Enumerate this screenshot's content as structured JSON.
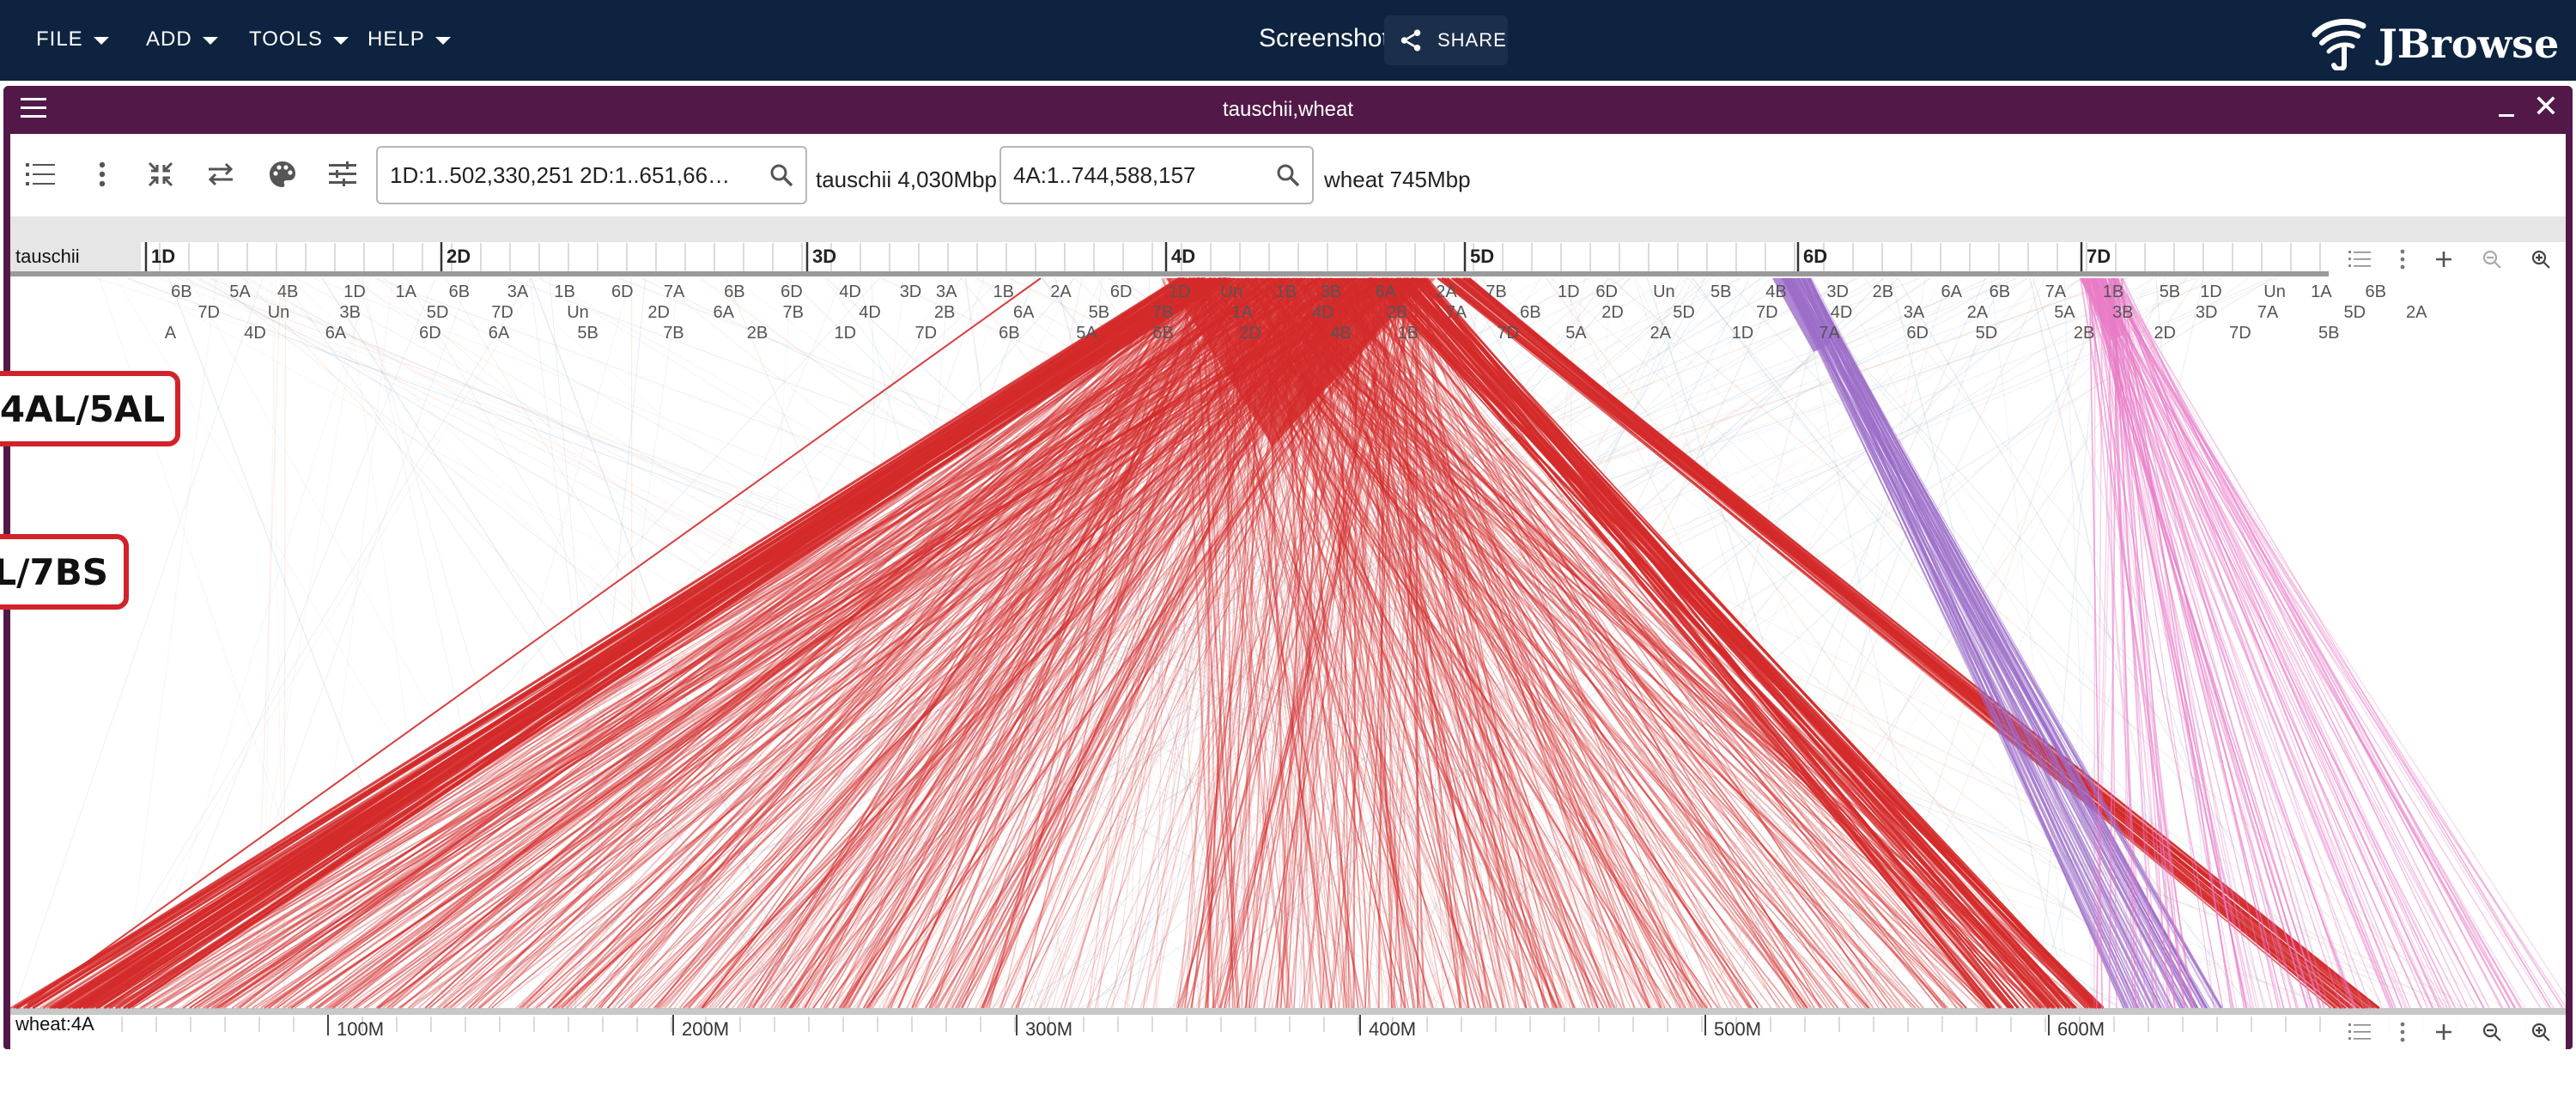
{
  "app": {
    "menus": [
      "FILE",
      "ADD",
      "TOOLS",
      "HELP"
    ],
    "title": "Screenshot",
    "share_label": "SHARE",
    "logo_text": "JBrowse",
    "header_color": "#0d233f"
  },
  "view": {
    "title": "tauschii,wheat",
    "header_color": "#521948",
    "location_1": "1D:1..502,330,251 2D:1..651,66…",
    "assembly_1_info": "tauschii 4,030Mbp",
    "location_2": "4A:1..744,588,157",
    "assembly_2_info": "wheat 745Mbp",
    "top_assembly_name": "tauschii",
    "bottom_assembly_name": "wheat:4A",
    "top_chromosomes": [
      "1D",
      "2D",
      "3D",
      "4D",
      "5D",
      "6D",
      "7D"
    ],
    "bottom_ticks": [
      "100M",
      "200M",
      "300M",
      "400M",
      "500M",
      "600M"
    ],
    "feature_label_rows": [
      [
        "6B",
        "5A",
        "4B",
        "1D",
        "1A",
        "6B",
        "3A",
        "1B",
        "6D",
        "7A",
        "6B",
        "6D",
        "4D",
        "3D",
        "3A",
        "1B",
        "2A",
        "6D",
        "1D",
        "Un",
        "1B",
        "3B",
        "6A",
        "2A",
        "7B",
        "1D",
        "6D",
        "Un",
        "5B",
        "4B",
        "3D",
        "2B",
        "6A",
        "6B",
        "7A",
        "1B",
        "5B",
        "1D",
        "Un",
        "1A",
        "6B",
        "1D"
      ],
      [
        "7D",
        "Un",
        "3B",
        "5D",
        "7D",
        "Un",
        "2D",
        "6A",
        "7B",
        "4D",
        "2B",
        "6A",
        "5B",
        "7B",
        "1A",
        "4D",
        "2B",
        "7A",
        "6B",
        "2D",
        "5D",
        "7D",
        "4D",
        "3A",
        "2A",
        "5A",
        "3B",
        "3D",
        "7A",
        "5D",
        "2A",
        "6A"
      ],
      [
        "A",
        "4D",
        "6A",
        "6D",
        "6A",
        "5B",
        "7B",
        "2B",
        "1D",
        "7D",
        "6B",
        "5A",
        "6B",
        "2D",
        "4B",
        "1B",
        "7D",
        "5A",
        "2A",
        "1D",
        "7A",
        "6D",
        "5D",
        "2B",
        "2D",
        "7D",
        "5B"
      ]
    ],
    "callouts": [
      "4AL/5AL",
      "L/7BS"
    ],
    "colors": {
      "synteny_main": "#d42a2a",
      "synteny_purple": "#9b6cc8",
      "synteny_pink": "#e87ac6"
    }
  }
}
